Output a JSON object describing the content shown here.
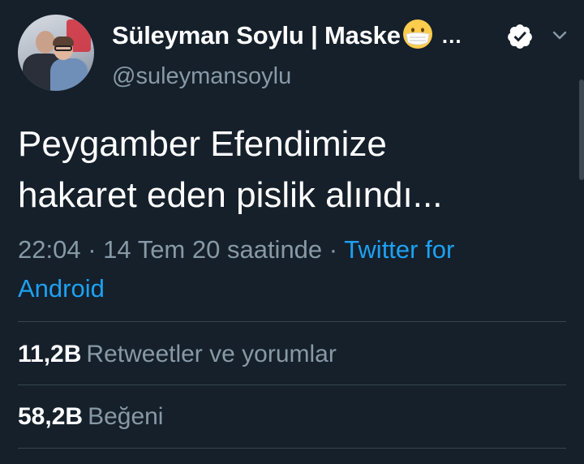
{
  "author": {
    "display_name": "Süleyman Soylu | Maske",
    "name_emoji": "mask-face-emoji",
    "truncation": "…",
    "handle": "@suleymansoylu",
    "verified": true
  },
  "tweet": {
    "text_line1": "Peygamber Efendimize",
    "text_line2": "hakaret eden pislik alındı...",
    "time": "22:04",
    "separator": "·",
    "date": "14 Tem 20 saatinde",
    "source": "Twitter for Android"
  },
  "stats": {
    "retweets_count": "11,2B",
    "retweets_label": "Retweetler ve yorumlar",
    "likes_count": "58,2B",
    "likes_label": "Beğeni"
  },
  "icons": {
    "verified": "verified-badge-icon",
    "menu": "chevron-down-icon"
  },
  "colors": {
    "background": "#15202b",
    "primary_text": "#ffffff",
    "secondary_text": "#8899a6",
    "link": "#1da1f2",
    "divider": "#38444d"
  }
}
